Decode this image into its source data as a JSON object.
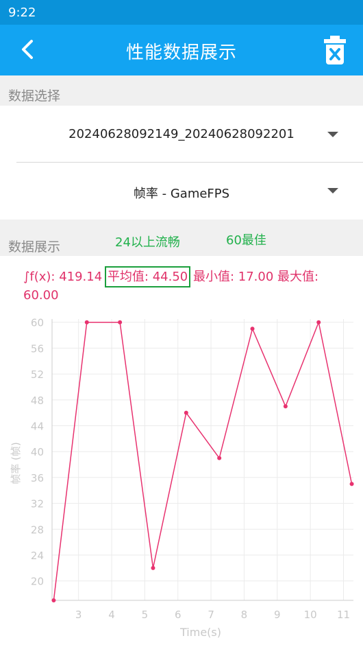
{
  "status_bar": {
    "time": "9:22"
  },
  "app_bar": {
    "title": "性能数据展示",
    "back_icon": "chevron-left-icon",
    "delete_icon": "trash-icon"
  },
  "data_select": {
    "header": "数据选择",
    "file_value": "20240628092149_20240628092201",
    "metric_value": "帧率 - GameFPS"
  },
  "data_display": {
    "header": "数据展示",
    "note_smooth": "24以上流畅",
    "note_best": "60最佳"
  },
  "stats": {
    "integral": "∫f(x): 419.14",
    "average": "平均值: 44.50",
    "min": "最小值: 17.00",
    "max_label": "最大值:",
    "max_value": "60.00"
  },
  "colors": {
    "appbar": "#12a4f2",
    "statusbar": "#0a92d9",
    "line": "#e8326f",
    "stats": "#e0326a",
    "note": "#22b14c"
  },
  "chart_data": {
    "type": "line",
    "xlabel": "Time(s)",
    "ylabel": "帧率 (帧)",
    "xlim": [
      2.2,
      11.3
    ],
    "ylim": [
      17,
      60.5
    ],
    "x_ticks": [
      3,
      4,
      5,
      6,
      7,
      8,
      9,
      10,
      11
    ],
    "y_ticks": [
      20,
      24,
      28,
      32,
      36,
      40,
      44,
      48,
      52,
      56,
      60
    ],
    "grid": true,
    "series": [
      {
        "x": [
          2.25,
          3.25,
          4.25,
          5.25,
          6.25,
          7.25,
          8.25,
          9.25,
          10.25,
          11.25
        ],
        "y": [
          17,
          60,
          60,
          22,
          46,
          39,
          59,
          47,
          60,
          35
        ]
      }
    ]
  }
}
